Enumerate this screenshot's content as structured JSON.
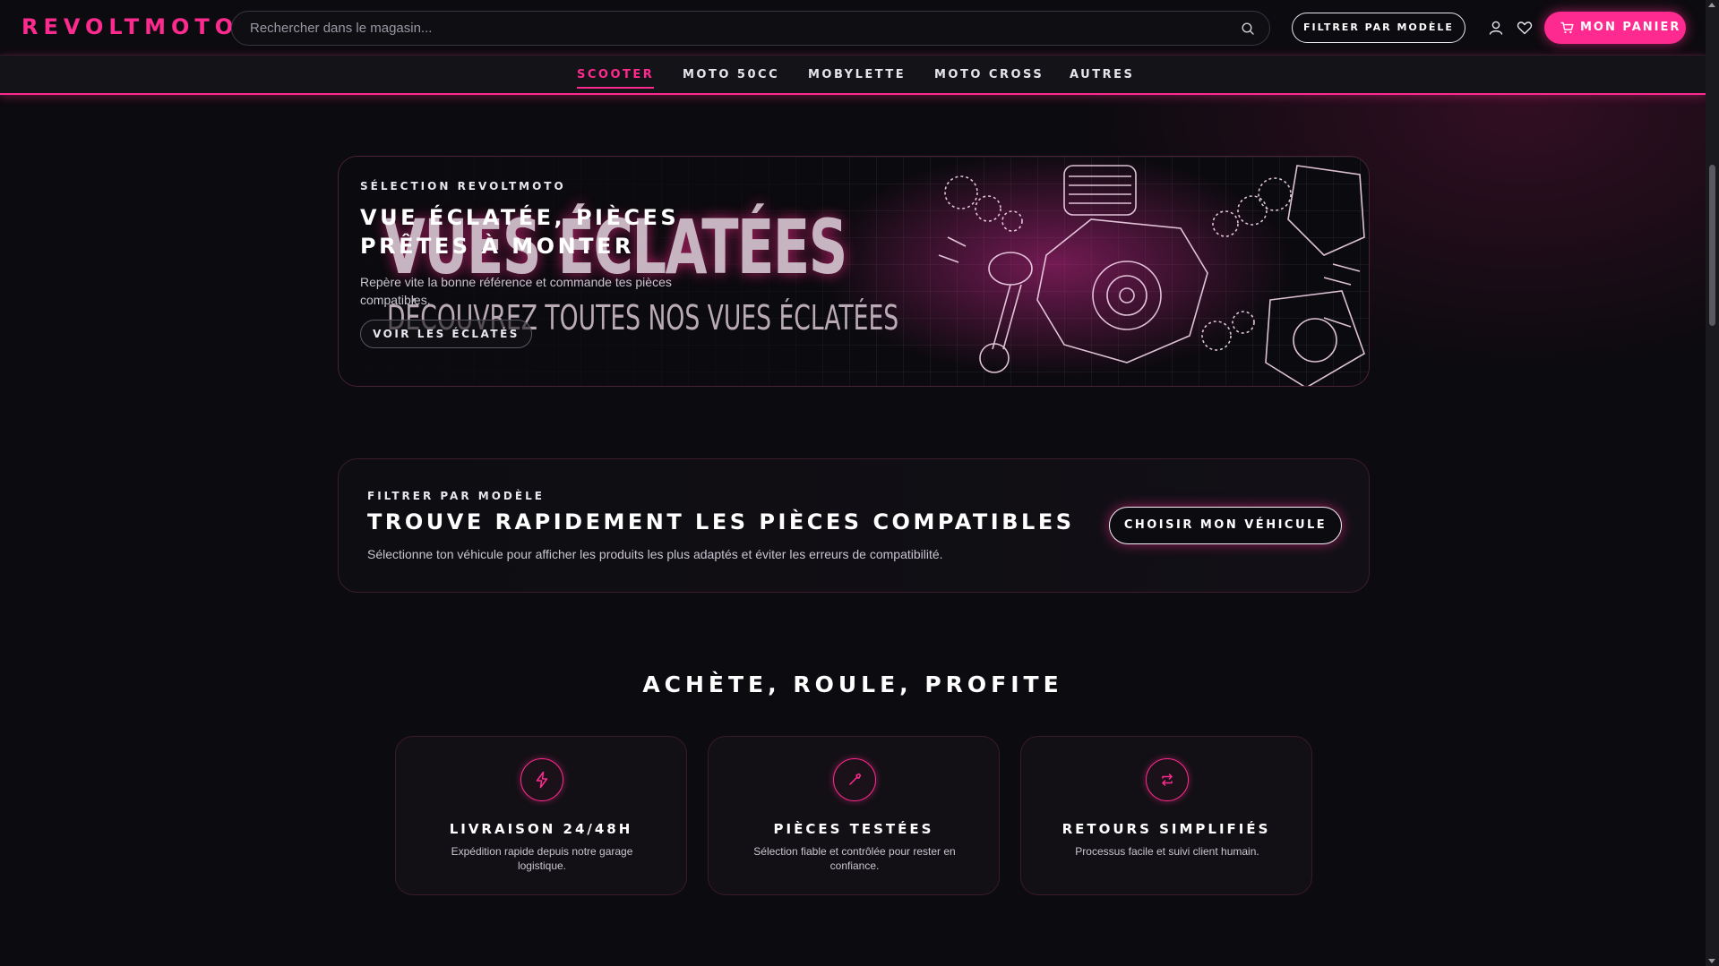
{
  "brand": {
    "logo": "REVOLTMOTO",
    "accent": "#ff2a8f"
  },
  "header": {
    "search_placeholder": "Rechercher dans le magasin...",
    "filter_label": "FILTRER PAR MODÈLE",
    "cart_label": "MON PANIER",
    "icons": [
      "search-icon",
      "user-icon",
      "heart-icon",
      "cart-icon"
    ]
  },
  "nav": {
    "items": [
      {
        "label": "SCOOTER",
        "active": true
      },
      {
        "label": "MOTO 50CC",
        "active": false
      },
      {
        "label": "MOBYLETTE",
        "active": false
      },
      {
        "label": "MOTO CROSS",
        "active": false
      },
      {
        "label": "AUTRES",
        "active": false
      }
    ]
  },
  "banner": {
    "eyebrow": "SÉLECTION REVOLTMOTO",
    "title": "VUE ÉCLATÉE, PIÈCES PRÊTES À MONTER",
    "description": "Repère vite la bonne référence et commande tes pièces compatibles.",
    "cta": "VOIR LES ÉCLATÉS",
    "image_text_big": "VUES ÉCLATÉES",
    "image_text_sub": "DÉCOUVREZ TOUTES NOS VUES ÉCLATÉES"
  },
  "filter_card": {
    "eyebrow": "FILTRER PAR MODÈLE",
    "title": "TROUVE RAPIDEMENT LES PIÈCES COMPATIBLES",
    "description": "Sélectionne ton véhicule pour afficher les produits les plus adaptés et éviter les erreurs de compatibilité.",
    "button": "CHOISIR MON VÉHICULE"
  },
  "features": {
    "heading": "ACHÈTE, ROULE, PROFITE",
    "items": [
      {
        "icon": "lightning-icon",
        "title": "LIVRAISON 24/48H",
        "description": "Expédition rapide depuis notre garage logistique."
      },
      {
        "icon": "wrench-icon",
        "title": "PIÈCES TESTÉES",
        "description": "Sélection fiable et contrôlée pour rester en confiance."
      },
      {
        "icon": "return-icon",
        "title": "RETOURS SIMPLIFIÉS",
        "description": "Processus facile et suivi client humain."
      }
    ]
  }
}
